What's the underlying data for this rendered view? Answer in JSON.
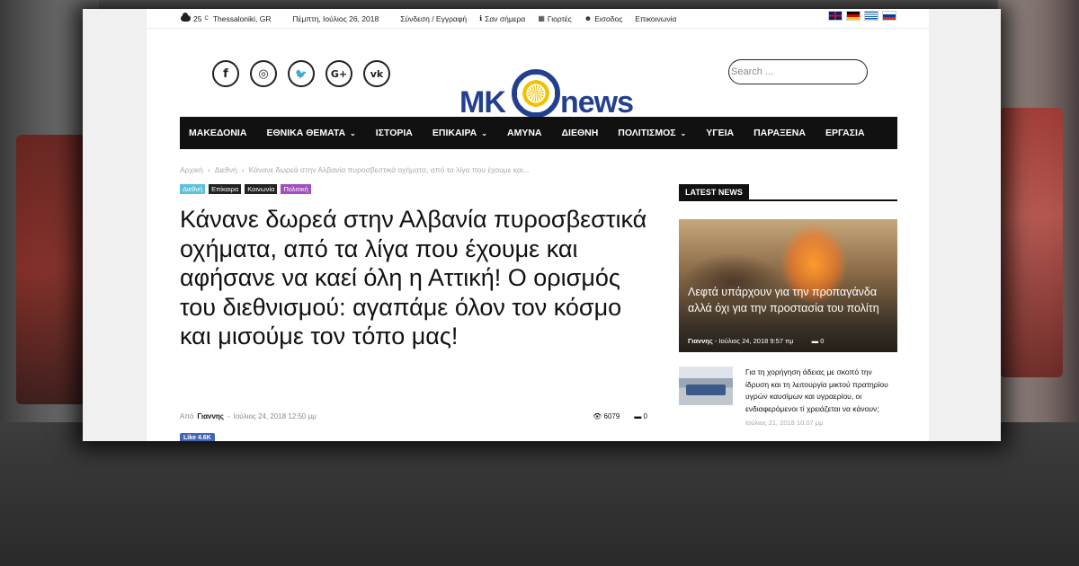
{
  "topbar": {
    "temperature": "25",
    "temp_unit": "C",
    "location": "Thessaloniki, GR",
    "date": "Πέμπτη, Ιούλιος 26, 2018",
    "links": [
      {
        "label": "Σύνδεση / Εγγραφή",
        "icon": ""
      },
      {
        "label": "Σαν σήμερα",
        "icon": "info-icon"
      },
      {
        "label": "Γιορτές",
        "icon": "calendar-icon"
      },
      {
        "label": "Εισοδος",
        "icon": "users-icon"
      },
      {
        "label": "Επικοινωνία",
        "icon": ""
      }
    ],
    "flags": [
      "uk",
      "de",
      "gr",
      "ru"
    ]
  },
  "header": {
    "socials": [
      "facebook",
      "instagram",
      "twitter",
      "google-plus",
      "vk"
    ],
    "social_glyphs": [
      "f",
      "◎",
      "🐦",
      "G+",
      "vk"
    ],
    "logo_left": "MK",
    "logo_right": "news",
    "search_placeholder": "Search ..."
  },
  "nav": {
    "items": [
      {
        "label": "ΜΑΚΕΔΟΝΙΑ",
        "dropdown": false
      },
      {
        "label": "ΕΘΝΙΚΑ ΘΕΜΑΤΑ",
        "dropdown": true
      },
      {
        "label": "ΙΣΤΟΡΙΑ",
        "dropdown": false
      },
      {
        "label": "ΕΠΙΚΑΙΡΑ",
        "dropdown": true
      },
      {
        "label": "ΑΜΥΝΑ",
        "dropdown": false
      },
      {
        "label": "ΔΙΕΘΝΗ",
        "dropdown": false
      },
      {
        "label": "ΠΟΛΙΤΙΣΜΟΣ",
        "dropdown": true
      },
      {
        "label": "ΥΓΕΙΑ",
        "dropdown": false
      },
      {
        "label": "ΠΑΡΑΞΕΝΑ",
        "dropdown": false
      },
      {
        "label": "ΕΡΓΑΣΙΑ",
        "dropdown": false
      }
    ]
  },
  "article": {
    "breadcrumb": [
      "Αρχική",
      "Διεθνή",
      "Κάνανε δωρεά στην Αλβανία πυροσβεστικά οχήματα, από τα λίγα που έχουμε και..."
    ],
    "categories": [
      {
        "label": "Διεθνή",
        "color": "#5bc0de"
      },
      {
        "label": "Επίκαιρα",
        "color": "#222222"
      },
      {
        "label": "Κοινωνία",
        "color": "#222222"
      },
      {
        "label": "Πολιτική",
        "color": "#a24fbd"
      }
    ],
    "title": "Κάνανε δωρεά στην Αλβανία πυροσβεστικά οχήματα, από τα λίγα που έχουμε και αφήσανε να καεί όλη η Αττική! Ο ορισμός του διεθνισμού: αγαπάμε όλον τον κόσμο και μισούμε τον τόπο μας!",
    "by_label": "Από",
    "author": "Γιαννης",
    "date": "Ιούλιος 24, 2018 12:50 μμ",
    "views": "6079",
    "comments": "0",
    "fb_like": "Like 4.6K"
  },
  "sidebar": {
    "tab_label": "LATEST NEWS",
    "feature": {
      "title": "Λεφτά υπάρχουν για την προπαγάνδα αλλά όχι για την προστασία του πολίτη",
      "author": "Γιαννης",
      "date": "Ιούλιος 24, 2018 9:57 πμ",
      "comments": "0"
    },
    "item": {
      "title": "Για τη χορήγηση άδειας με σκοπό την ίδρυση και τη λειτουργία μικτού πρατηρίου υγρών καυσίμων και υγραερίου, οι ενδιαφερόμενοι τί χρειάζεται να κάνουν;",
      "date": "Ιούλιος 21, 2018 10:07 μμ"
    }
  }
}
